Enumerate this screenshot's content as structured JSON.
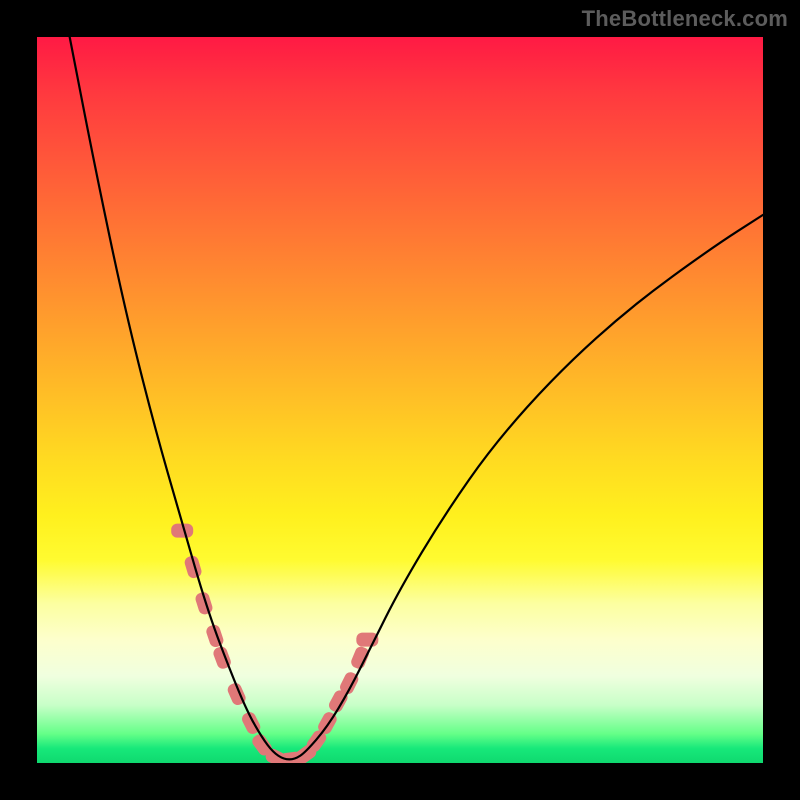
{
  "watermark": "TheBottleneck.com",
  "chart_data": {
    "type": "line",
    "title": "",
    "xlabel": "",
    "ylabel": "",
    "xlim": [
      0,
      1
    ],
    "ylim": [
      0,
      1
    ],
    "legend": false,
    "grid": false,
    "series": [
      {
        "name": "bottleneck-curve",
        "color": "#000000",
        "x": [
          0.045,
          0.08,
          0.12,
          0.16,
          0.2,
          0.235,
          0.265,
          0.29,
          0.31,
          0.325,
          0.34,
          0.355,
          0.37,
          0.4,
          0.43,
          0.46,
          0.5,
          0.56,
          0.63,
          0.72,
          0.82,
          0.93,
          1.0
        ],
        "y": [
          1.0,
          0.82,
          0.63,
          0.47,
          0.33,
          0.21,
          0.13,
          0.07,
          0.035,
          0.015,
          0.005,
          0.005,
          0.015,
          0.05,
          0.1,
          0.16,
          0.24,
          0.34,
          0.44,
          0.54,
          0.63,
          0.71,
          0.755
        ]
      },
      {
        "name": "highlight-markers",
        "color": "#e07878",
        "marker": "rounded-rect",
        "x": [
          0.2,
          0.215,
          0.23,
          0.245,
          0.255,
          0.275,
          0.295,
          0.31,
          0.33,
          0.35,
          0.37,
          0.385,
          0.4,
          0.415,
          0.43,
          0.445,
          0.455
        ],
        "y": [
          0.32,
          0.27,
          0.22,
          0.175,
          0.145,
          0.095,
          0.055,
          0.025,
          0.007,
          0.005,
          0.012,
          0.03,
          0.055,
          0.085,
          0.11,
          0.145,
          0.17
        ]
      }
    ],
    "background_gradient": {
      "type": "vertical",
      "stops": [
        {
          "pos": 0.0,
          "color": "#ff1a44"
        },
        {
          "pos": 0.5,
          "color": "#ffda21"
        },
        {
          "pos": 0.8,
          "color": "#fdffcc"
        },
        {
          "pos": 1.0,
          "color": "#0fd96f"
        }
      ]
    }
  }
}
